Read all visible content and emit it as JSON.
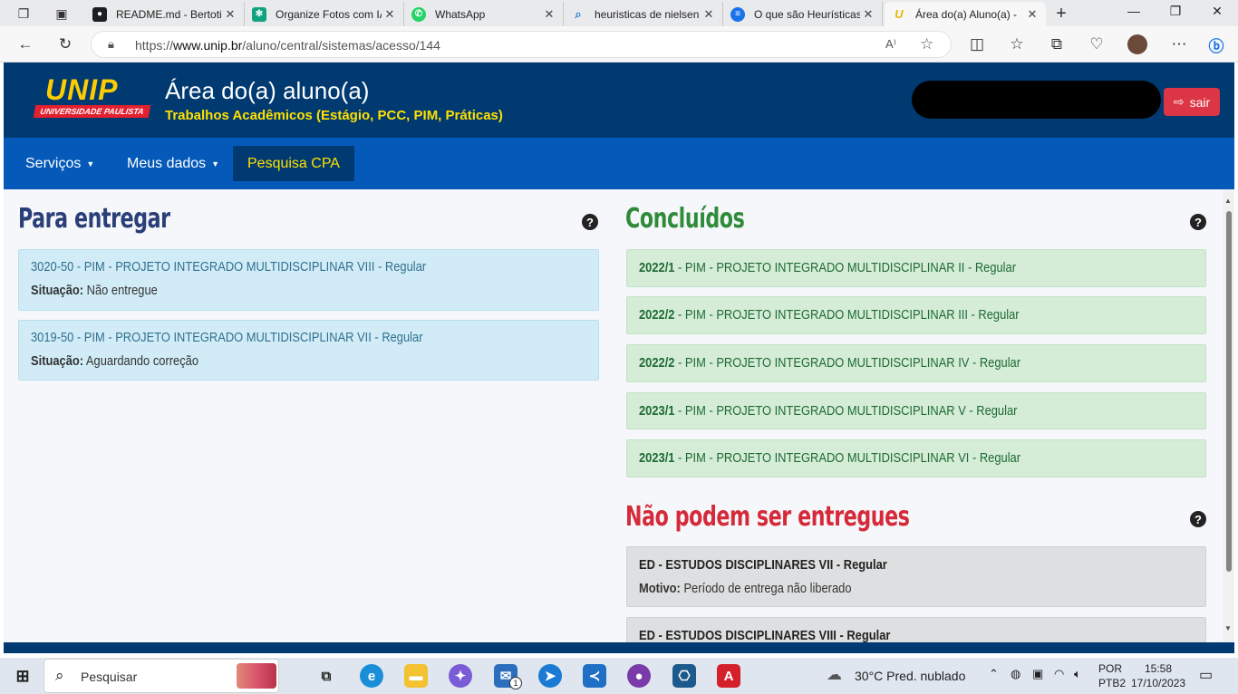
{
  "browser": {
    "tabs": [
      {
        "title": "README.md - Bertoti",
        "icon": "github-icon",
        "color": "#1b1f23"
      },
      {
        "title": "Organize Fotos com IA",
        "icon": "chatgpt-icon",
        "color": "#10a37f"
      },
      {
        "title": "WhatsApp",
        "icon": "whatsapp-icon",
        "color": "#25d366"
      },
      {
        "title": "heuristicas de nielsen",
        "icon": "search-icon",
        "color": "#2d7bd1"
      },
      {
        "title": "O que são Heurísticas",
        "icon": "doc-icon",
        "color": "#1a73e8"
      },
      {
        "title": "Área do(a) Aluno(a) - ",
        "icon": "unip-icon",
        "color": "#ffcc00",
        "active": true
      }
    ],
    "url_prefix": "https://",
    "url_domain": "www.unip.br",
    "url_path": "/aluno/central/sistemas/acesso/144"
  },
  "header": {
    "logo_text": "UNIP",
    "logo_band": "UNIVERSIDADE PAULISTA",
    "title": "Área do(a) aluno(a)",
    "subtitle": "Trabalhos Acadêmicos (Estágio, PCC, PIM, Práticas)",
    "logout_label": "sair"
  },
  "nav": {
    "servicos": "Serviços",
    "meus_dados": "Meus dados",
    "pesquisa_cpa": "Pesquisa CPA"
  },
  "para_entregar": {
    "title": "Para entregar",
    "items": [
      {
        "name": "3020-50 - PIM - PROJETO INTEGRADO MULTIDISCIPLINAR VIII - Regular",
        "status_label": "Situação:",
        "status": " Não entregue"
      },
      {
        "name": "3019-50 - PIM - PROJETO INTEGRADO MULTIDISCIPLINAR VII - Regular",
        "status_label": "Situação:",
        "status": " Aguardando correção"
      }
    ]
  },
  "concluidos": {
    "title": "Concluídos",
    "items": [
      {
        "period": "2022/1",
        "name": " - PIM - PROJETO INTEGRADO MULTIDISCIPLINAR II - Regular"
      },
      {
        "period": "2022/2",
        "name": " - PIM - PROJETO INTEGRADO MULTIDISCIPLINAR III - Regular"
      },
      {
        "period": "2022/2",
        "name": " - PIM - PROJETO INTEGRADO MULTIDISCIPLINAR IV - Regular"
      },
      {
        "period": "2023/1",
        "name": " - PIM - PROJETO INTEGRADO MULTIDISCIPLINAR V - Regular"
      },
      {
        "period": "2023/1",
        "name": " - PIM - PROJETO INTEGRADO MULTIDISCIPLINAR VI - Regular"
      }
    ]
  },
  "nao_podem": {
    "title": "Não podem ser entregues",
    "items": [
      {
        "name": "ED - ESTUDOS DISCIPLINARES VII - Regular",
        "reason_label": "Motivo:",
        "reason": " Período de entrega não liberado"
      },
      {
        "name": "ED - ESTUDOS DISCIPLINARES VIII - Regular"
      }
    ]
  },
  "taskbar": {
    "search_placeholder": "Pesquisar",
    "weather": "30°C  Pred. nublado",
    "lang_1": "POR",
    "lang_2": "PTB2",
    "time": "15:58",
    "date": "17/10/2023",
    "mail_badge": "1"
  },
  "colors": {
    "header_bg": "#003a70",
    "nav_bg": "#0459b9",
    "accent_yellow": "#ffe000",
    "para_entregar": "#2a3e78",
    "concluidos": "#2e8b3a",
    "nao_podem": "#d52a3a"
  }
}
